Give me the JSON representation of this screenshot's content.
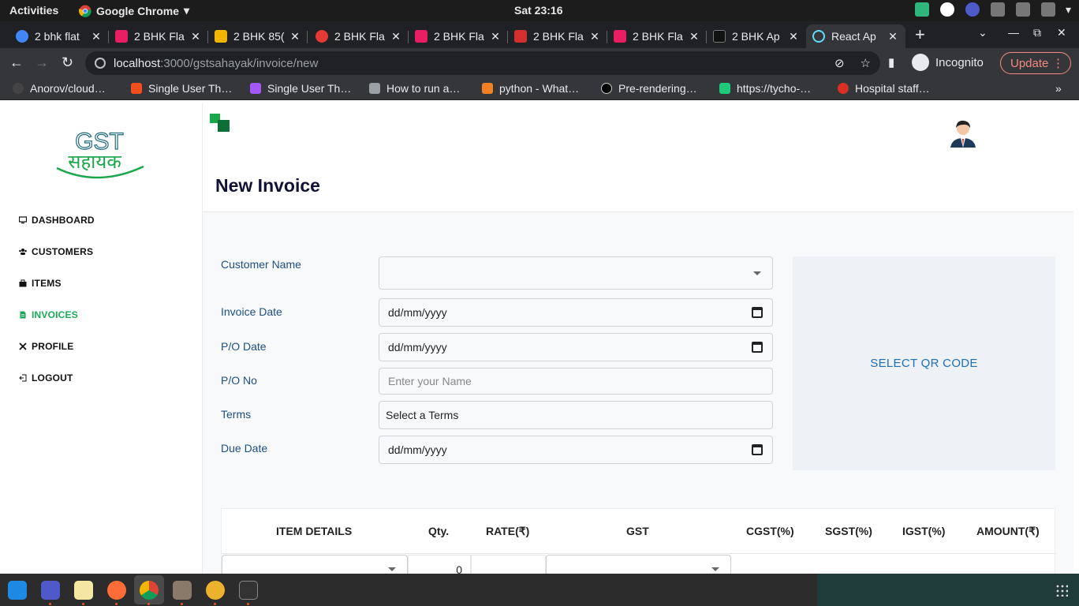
{
  "system_bar": {
    "activities": "Activities",
    "app_name": "Google Chrome",
    "clock": "Sat 23:16"
  },
  "tabs": [
    {
      "label": "2 bhk flat",
      "color": "#4285f4"
    },
    {
      "label": "2 BHK Fla",
      "color": "#e91e63"
    },
    {
      "label": "2 BHK 85(",
      "color": "#f4b400"
    },
    {
      "label": "2 BHK Fla",
      "color": "#e53935"
    },
    {
      "label": "2 BHK Fla",
      "color": "#e91e63"
    },
    {
      "label": "2 BHK Fla",
      "color": "#d32f2f"
    },
    {
      "label": "2 BHK Fla",
      "color": "#e91e63"
    },
    {
      "label": "2 BHK Ap",
      "color": "#111111"
    },
    {
      "label": "React Ap",
      "color": "#61dafb"
    }
  ],
  "toolbar": {
    "url_host": "localhost",
    "url_path": ":3000/gstsahayak/invoice/new",
    "incognito_label": "Incognito",
    "update_label": "Update"
  },
  "bookmarks": [
    {
      "label": "Anorov/cloud…",
      "color": "#6e6e6e"
    },
    {
      "label": "Single User Th…",
      "color": "#f24e1e"
    },
    {
      "label": "Single User Th…",
      "color": "#f24e1e"
    },
    {
      "label": "How to run a…",
      "color": "#9aa0a6"
    },
    {
      "label": "python - What…",
      "color": "#f48024"
    },
    {
      "label": "Pre-rendering…",
      "color": "#000000"
    },
    {
      "label": "https://tycho-…",
      "color": "#1ec97a"
    },
    {
      "label": "Hospital staff…",
      "color": "#d93025"
    }
  ],
  "sidebar": {
    "logo_text_top": "GST",
    "logo_text_bottom": "सहायक",
    "items": [
      {
        "label": "DASHBOARD",
        "icon": "monitor-icon",
        "active": false
      },
      {
        "label": "CUSTOMERS",
        "icon": "users-icon",
        "active": false
      },
      {
        "label": "ITEMS",
        "icon": "briefcase-icon",
        "active": false
      },
      {
        "label": "INVOICES",
        "icon": "file-icon",
        "active": true
      },
      {
        "label": "PROFILE",
        "icon": "tools-icon",
        "active": false
      },
      {
        "label": "LOGOUT",
        "icon": "logout-icon",
        "active": false
      }
    ]
  },
  "page": {
    "title": "New Invoice"
  },
  "form": {
    "customer_name_label": "Customer Name",
    "invoice_date_label": "Invoice Date",
    "invoice_date_value": "dd/mm/yyyy",
    "po_date_label": "P/O Date",
    "po_date_value": "dd/mm/yyyy",
    "po_no_label": "P/O No",
    "po_no_placeholder": "Enter your Name",
    "terms_label": "Terms",
    "terms_value": "Select a Terms",
    "due_date_label": "Due Date",
    "due_date_value": "dd/mm/yyyy"
  },
  "qr": {
    "label": "SELECT QR CODE"
  },
  "items_table": {
    "headers": [
      "ITEM DETAILS",
      "Qty.",
      "RATE(₹)",
      "GST",
      "CGST(%)",
      "SGST(%)",
      "IGST(%)",
      "AMOUNT(₹)"
    ],
    "row": {
      "qty": "0"
    }
  },
  "colors": {
    "accent_green": "#1aaa55",
    "label_blue": "#1d4e84",
    "qr_blue": "#1d6fb8"
  }
}
